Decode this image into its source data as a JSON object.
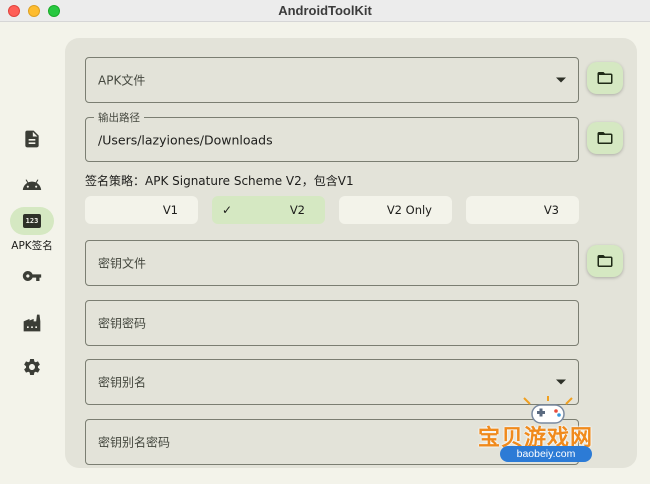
{
  "window": {
    "title": "AndroidToolKit"
  },
  "nav": {
    "items": [
      {
        "icon": "document-icon"
      },
      {
        "icon": "android-icon"
      },
      {
        "icon": "numbers-123-icon",
        "badge": "123",
        "label": "APK签名",
        "active": true
      },
      {
        "icon": "key-icon"
      },
      {
        "icon": "factory-icon"
      },
      {
        "icon": "settings-gear-icon"
      }
    ]
  },
  "form": {
    "apk_file": {
      "placeholder": "APK文件"
    },
    "output_path": {
      "label": "输出路径",
      "value": "/Users/lazyiones/Downloads"
    },
    "strategy": {
      "text": "签名策略：APK Signature Scheme V2，包含V1",
      "options": [
        {
          "label": "V1",
          "selected": false
        },
        {
          "label": "V2",
          "selected": true,
          "check": "✓"
        },
        {
          "label": "V2 Only",
          "selected": false
        },
        {
          "label": "V3",
          "selected": false
        }
      ]
    },
    "key_file": {
      "placeholder": "密钥文件"
    },
    "key_password": {
      "placeholder": "密钥密码"
    },
    "key_alias": {
      "placeholder": "密钥别名"
    },
    "key_alias_password": {
      "placeholder": "密钥别名密码"
    }
  },
  "watermark": {
    "text": "宝贝游戏网",
    "url": "baobeiy.com"
  },
  "colors": {
    "accent_container": "#d5e8c2",
    "card_background": "#e3e3d9",
    "window_background": "#f3f3ea"
  }
}
